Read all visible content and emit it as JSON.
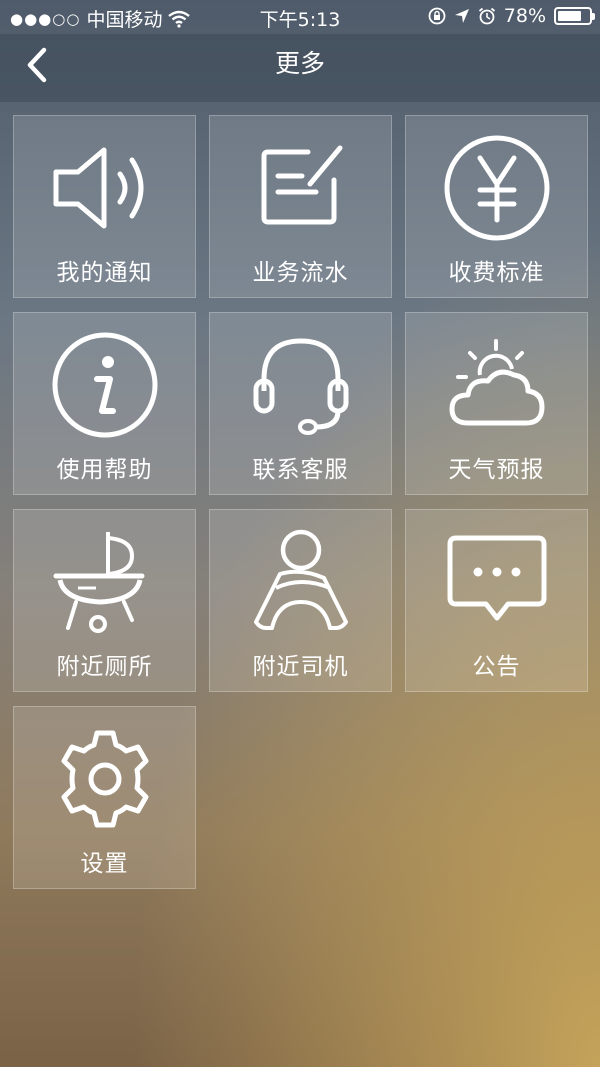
{
  "status_bar": {
    "signal_dots": "●●●○○",
    "carrier": "中国移动",
    "time": "下午5:13",
    "battery": "78%",
    "battery_level": 0.78
  },
  "nav": {
    "title": "更多",
    "back_icon": "chevron-left-icon"
  },
  "tiles": [
    {
      "label": "我的通知",
      "icon": "speaker-icon"
    },
    {
      "label": "业务流水",
      "icon": "edit-note-icon"
    },
    {
      "label": "收费标准",
      "icon": "yen-icon"
    },
    {
      "label": "使用帮助",
      "icon": "info-icon"
    },
    {
      "label": "联系客服",
      "icon": "headset-icon"
    },
    {
      "label": "天气预报",
      "icon": "weather-icon"
    },
    {
      "label": "附近厕所",
      "icon": "grill-icon"
    },
    {
      "label": "附近司机",
      "icon": "driver-icon"
    },
    {
      "label": "公告",
      "icon": "chat-bubble-icon"
    },
    {
      "label": "设置",
      "icon": "gear-icon"
    }
  ],
  "colors": {
    "text": "#ffffff",
    "nav_background": "#3c4856",
    "tile_background": "rgba(255,255,255,0.14)"
  }
}
